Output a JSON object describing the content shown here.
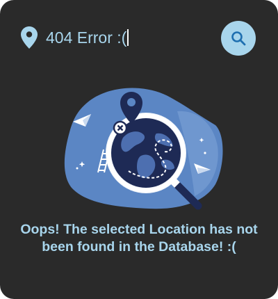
{
  "search": {
    "value": "404 Error :(",
    "location_icon": "map-pin-icon",
    "button_icon": "search-icon"
  },
  "illustration": {
    "name": "lost-location-globe-illustration"
  },
  "message": {
    "text": "Oops! The selected Location has not been found in the Database! :("
  },
  "colors": {
    "background": "#2a2a2a",
    "accent": "#a8d5ec",
    "illustration_blue": "#5b86c4",
    "illustration_dark": "#1e2a55"
  }
}
